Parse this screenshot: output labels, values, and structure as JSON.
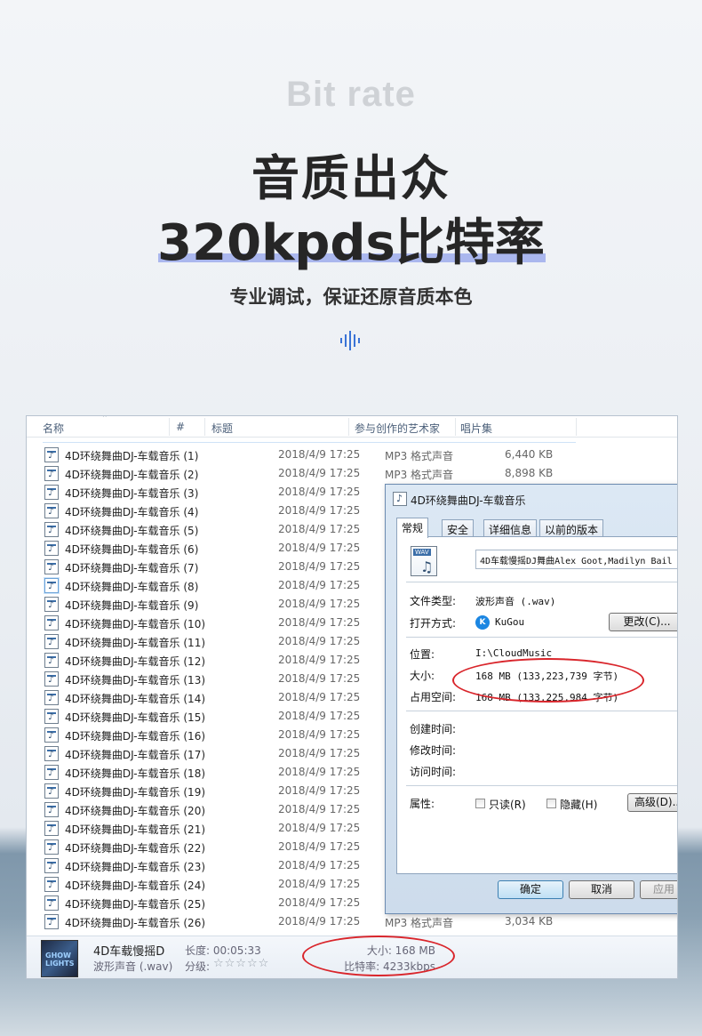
{
  "hero": {
    "kicker": "Bit rate",
    "title_line1": "音质出众",
    "title_line2": "320kpds比特率",
    "subtitle": "专业调试，保证还原音质本色"
  },
  "explorer": {
    "columns": [
      "名称",
      "#",
      "标题",
      "参与创作的艺术家",
      "唱片集"
    ],
    "rows": [
      {
        "name": "4D环绕舞曲DJ-车载音乐 (1)",
        "date": "2018/4/9 17:25",
        "type": "MP3 格式声音",
        "size": "6,440 KB"
      },
      {
        "name": "4D环绕舞曲DJ-车载音乐 (2)",
        "date": "2018/4/9 17:25",
        "type": "MP3 格式声音",
        "size": "8,898 KB"
      },
      {
        "name": "4D环绕舞曲DJ-车载音乐 (3)",
        "date": "2018/4/9 17:25"
      },
      {
        "name": "4D环绕舞曲DJ-车载音乐 (4)",
        "date": "2018/4/9 17:25"
      },
      {
        "name": "4D环绕舞曲DJ-车载音乐 (5)",
        "date": "2018/4/9 17:25"
      },
      {
        "name": "4D环绕舞曲DJ-车载音乐 (6)",
        "date": "2018/4/9 17:25"
      },
      {
        "name": "4D环绕舞曲DJ-车载音乐 (7)",
        "date": "2018/4/9 17:25"
      },
      {
        "name": "4D环绕舞曲DJ-车载音乐 (8)",
        "date": "2018/4/9 17:25"
      },
      {
        "name": "4D环绕舞曲DJ-车载音乐 (9)",
        "date": "2018/4/9 17:25"
      },
      {
        "name": "4D环绕舞曲DJ-车载音乐 (10)",
        "date": "2018/4/9 17:25"
      },
      {
        "name": "4D环绕舞曲DJ-车载音乐 (11)",
        "date": "2018/4/9 17:25"
      },
      {
        "name": "4D环绕舞曲DJ-车载音乐 (12)",
        "date": "2018/4/9 17:25"
      },
      {
        "name": "4D环绕舞曲DJ-车载音乐 (13)",
        "date": "2018/4/9 17:25"
      },
      {
        "name": "4D环绕舞曲DJ-车载音乐 (14)",
        "date": "2018/4/9 17:25"
      },
      {
        "name": "4D环绕舞曲DJ-车载音乐 (15)",
        "date": "2018/4/9 17:25"
      },
      {
        "name": "4D环绕舞曲DJ-车载音乐 (16)",
        "date": "2018/4/9 17:25"
      },
      {
        "name": "4D环绕舞曲DJ-车载音乐 (17)",
        "date": "2018/4/9 17:25"
      },
      {
        "name": "4D环绕舞曲DJ-车载音乐 (18)",
        "date": "2018/4/9 17:25"
      },
      {
        "name": "4D环绕舞曲DJ-车载音乐 (19)",
        "date": "2018/4/9 17:25"
      },
      {
        "name": "4D环绕舞曲DJ-车载音乐 (20)",
        "date": "2018/4/9 17:25"
      },
      {
        "name": "4D环绕舞曲DJ-车载音乐 (21)",
        "date": "2018/4/9 17:25"
      },
      {
        "name": "4D环绕舞曲DJ-车载音乐 (22)",
        "date": "2018/4/9 17:25"
      },
      {
        "name": "4D环绕舞曲DJ-车载音乐 (23)",
        "date": "2018/4/9 17:25"
      },
      {
        "name": "4D环绕舞曲DJ-车载音乐 (24)",
        "date": "2018/4/9 17:25"
      },
      {
        "name": "4D环绕舞曲DJ-车载音乐 (25)",
        "date": "2018/4/9 17:25"
      },
      {
        "name": "4D环绕舞曲DJ-车载音乐 (26)",
        "date": "2018/4/9 17:25",
        "type": "MP3 格式声音",
        "size": "3,034 KB"
      }
    ],
    "selected_row": 7,
    "details": {
      "title": "4D车载慢摇D",
      "subtitle": "波形声音 (.wav)",
      "length_label": "长度: 00:05:33",
      "rating_label": "分级:",
      "stars": "☆☆☆☆☆",
      "size_label": "大小: 168 MB",
      "bitrate_label": "比特率: 4233kbps",
      "album_art_text": "GHOW LIGHTS"
    }
  },
  "dialog": {
    "title": "4D环绕舞曲DJ-车载音乐",
    "tabs": [
      "常规",
      "安全",
      "详细信息",
      "以前的版本"
    ],
    "filename": "4D车载慢摇DJ舞曲Alex Goot,Madilyn Bail",
    "icon_tag": "WAV",
    "file_type_label": "文件类型:",
    "file_type": "波形声音 (.wav)",
    "open_with_label": "打开方式:",
    "open_with": "KuGou",
    "change_button": "更改(C)...",
    "location_label": "位置:",
    "location": "I:\\CloudMusic",
    "size_label": "大小:",
    "size": "168 MB (133,223,739 字节)",
    "disk_label": "占用空间:",
    "disk_size": "168 MB (133,225,984 字节)",
    "created_label": "创建时间:",
    "modified_label": "修改时间:",
    "accessed_label": "访问时间:",
    "attributes_label": "属性:",
    "readonly_label": "只读(R)",
    "hidden_label": "隐藏(H)",
    "advanced_button": "高级(D)...",
    "ok_button": "确定",
    "cancel_button": "取消",
    "apply_button": "应用"
  },
  "colors": {
    "title": "#262626",
    "kicker": "#cfd2d6",
    "underline": "#aab7ee",
    "highlight_ring": "#d9252b"
  }
}
